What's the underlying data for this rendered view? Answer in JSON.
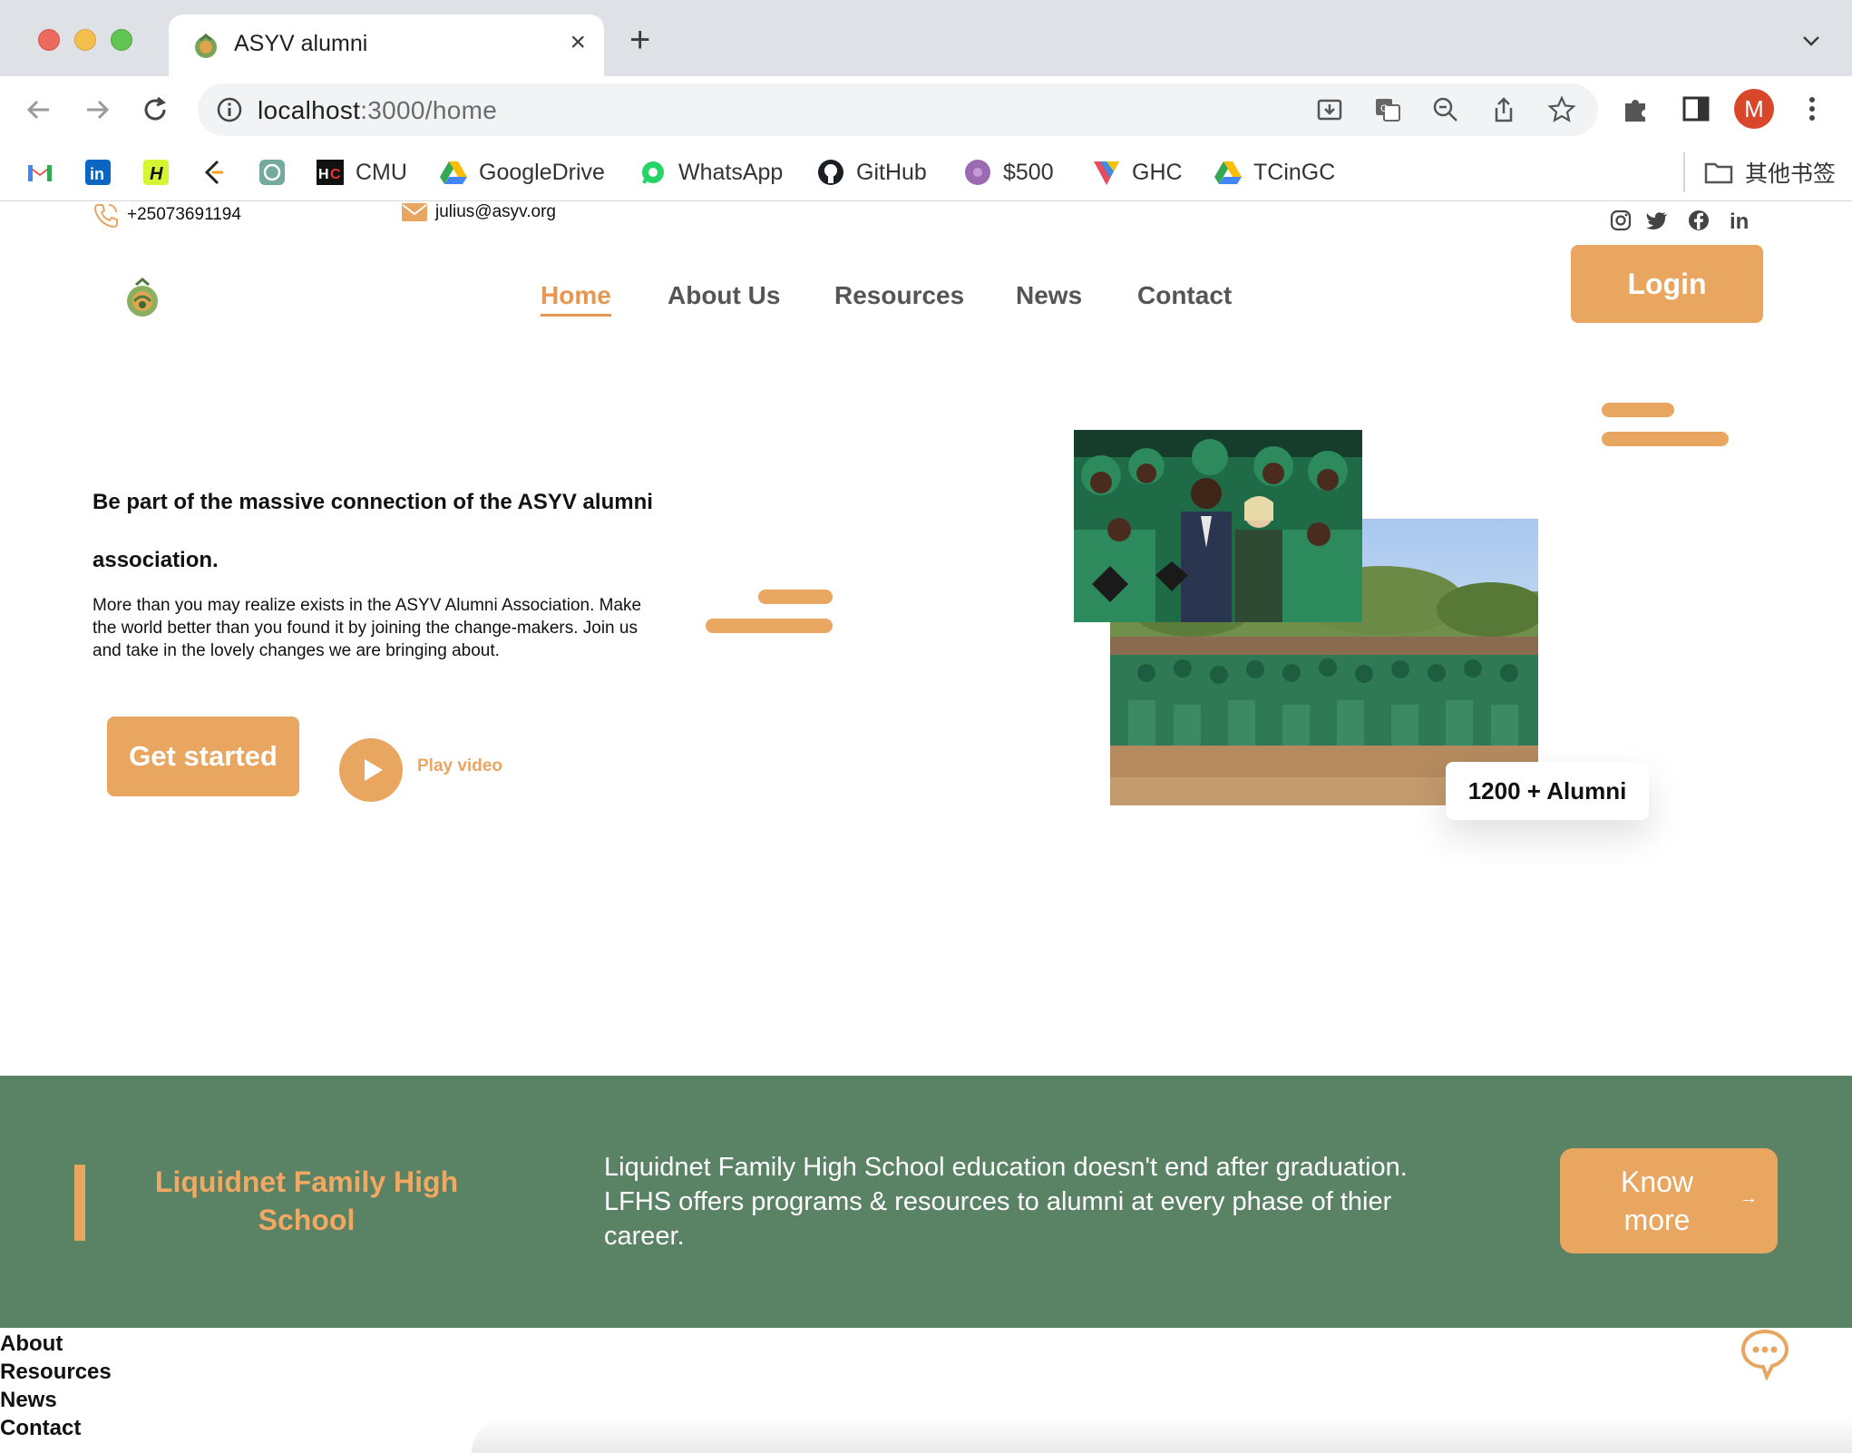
{
  "browser": {
    "tab_title": "ASYV alumni",
    "url_host": "localhost",
    "url_rest": ":3000/home",
    "profile_initial": "M",
    "bookmarks": [
      {
        "label": "",
        "icon": "gmail-icon"
      },
      {
        "label": "",
        "icon": "linkedin-icon"
      },
      {
        "label": "",
        "icon": "handshake-icon"
      },
      {
        "label": "",
        "icon": "leetcode-icon"
      },
      {
        "label": "",
        "icon": "chatgpt-icon"
      },
      {
        "label": "CMU",
        "icon": "hc-icon"
      },
      {
        "label": "GoogleDrive",
        "icon": "google-drive-icon"
      },
      {
        "label": "WhatsApp",
        "icon": "whatsapp-icon"
      },
      {
        "label": "GitHub",
        "icon": "github-icon"
      },
      {
        "label": "$500",
        "icon": "purple-circle-icon"
      },
      {
        "label": "GHC",
        "icon": "ghc-icon"
      },
      {
        "label": "TCinGC",
        "icon": "google-drive-icon"
      }
    ],
    "other_bookmarks": "其他书签"
  },
  "site": {
    "phone": "+25073691194",
    "email": "julius@asyv.org",
    "nav": [
      "Home",
      "About Us",
      "Resources",
      "News",
      "Contact"
    ],
    "login": "Login",
    "hero": {
      "title": "Be part of the massive connection of the ASYV alumni association.",
      "text": "More than you may realize exists in the ASYV Alumni Association. Make the world better than you found it by joining the change-makers. Join us and take in the lovely changes we are bringing about.",
      "cta": "Get started",
      "play": "Play video",
      "badge": "1200 + Alumni"
    },
    "band": {
      "title": "Liquidnet Family High School",
      "text": "Liquidnet Family High School education doesn't end after graduation. LFHS offers programs & resources to alumni at every phase of thier career.",
      "button": "Know more",
      "arrow": "→"
    },
    "footer_links": [
      "About",
      "Resources",
      "News",
      "Contact"
    ]
  },
  "colors": {
    "accent": "#e8a661",
    "band": "#5a8264",
    "band_title": "#f0a862"
  }
}
